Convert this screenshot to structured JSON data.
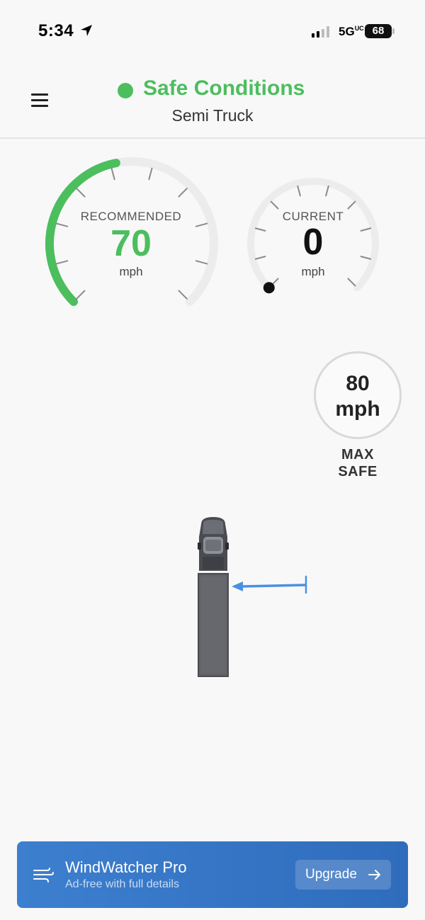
{
  "status_bar": {
    "time": "5:34",
    "network": "5G",
    "network_suffix": "UC",
    "battery": "68",
    "battery_level": 0.68,
    "icons": [
      "location-arrow-icon",
      "cellular-signal-icon",
      "battery-icon"
    ]
  },
  "header": {
    "status": "Safe Conditions",
    "status_color": "#4cbe5e",
    "vehicle": "Semi Truck",
    "icons": [
      "hamburger-menu-icon"
    ]
  },
  "gauges": {
    "recommended": {
      "label": "RECOMMENDED",
      "value": "70",
      "unit": "mph",
      "color": "#4cbe5e"
    },
    "current": {
      "label": "CURRENT",
      "value": "0",
      "unit": "mph",
      "color": "#111111"
    }
  },
  "max_safe": {
    "value": "80",
    "unit": "mph",
    "label_line1": "MAX",
    "label_line2": "SAFE"
  },
  "scene": {
    "icons": [
      "semi-truck-icon",
      "wind-direction-arrow-icon"
    ],
    "wind_color": "#4a90e2"
  },
  "banner": {
    "title": "WindWatcher Pro",
    "subtitle": "Ad-free with full details",
    "button_label": "Upgrade",
    "icons": [
      "wind-icon",
      "arrow-right-icon"
    ],
    "colors": {
      "start": "#3d7fcf",
      "end": "#2f6cbc"
    }
  }
}
